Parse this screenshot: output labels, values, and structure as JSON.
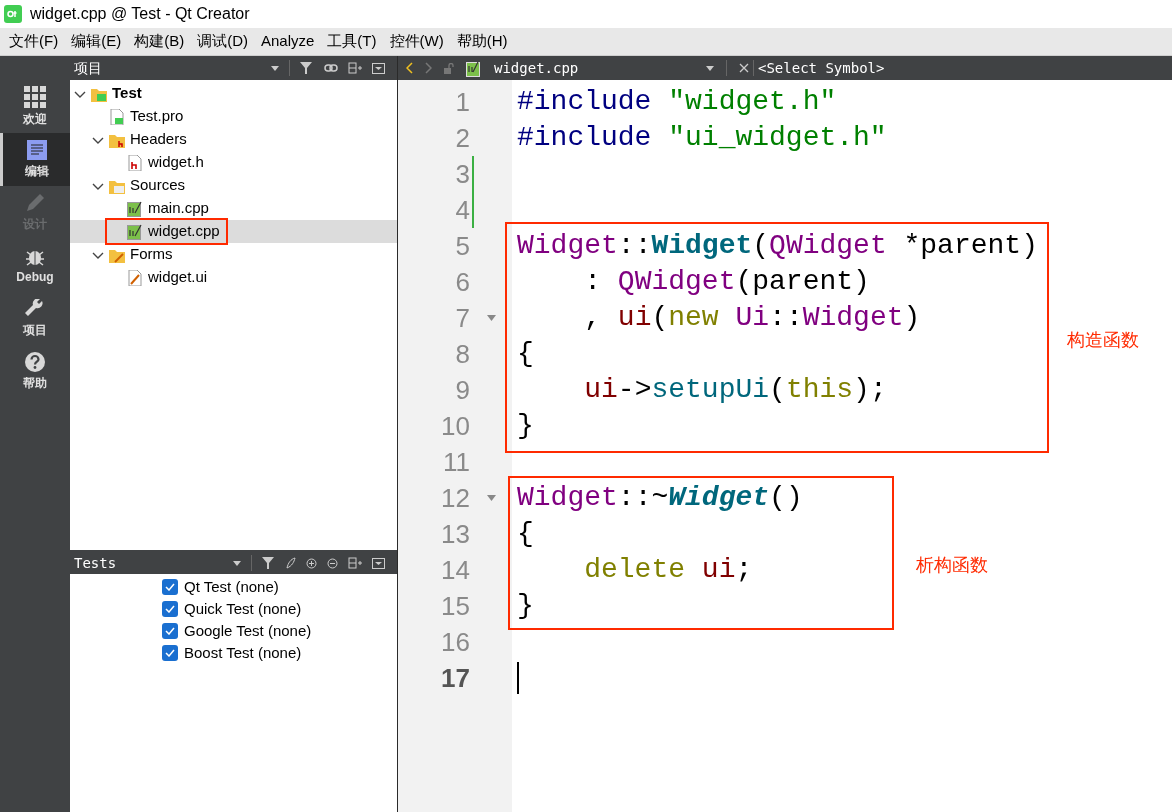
{
  "window": {
    "title": "widget.cpp @ Test - Qt Creator"
  },
  "menu": [
    "文件(F)",
    "编辑(E)",
    "构建(B)",
    "调试(D)",
    "Analyze",
    "工具(T)",
    "控件(W)",
    "帮助(H)"
  ],
  "modes": [
    {
      "label": "欢迎",
      "kind": "welcome",
      "selected": false,
      "disabled": false
    },
    {
      "label": "编辑",
      "kind": "edit",
      "selected": true,
      "disabled": false
    },
    {
      "label": "设计",
      "kind": "design",
      "selected": false,
      "disabled": true
    },
    {
      "label": "Debug",
      "kind": "debug",
      "selected": false,
      "disabled": false
    },
    {
      "label": "项目",
      "kind": "projects",
      "selected": false,
      "disabled": false
    },
    {
      "label": "帮助",
      "kind": "help",
      "selected": false,
      "disabled": false
    }
  ],
  "project_panel": {
    "title": "项目",
    "tree": [
      {
        "label": "Test",
        "kind": "project",
        "expanded": true,
        "selected": false,
        "children": [
          {
            "label": "Test.pro",
            "kind": "pro",
            "selected": false
          },
          {
            "label": "Headers",
            "kind": "headers",
            "expanded": true,
            "selected": false,
            "children": [
              {
                "label": "widget.h",
                "kind": "header",
                "selected": false
              }
            ]
          },
          {
            "label": "Sources",
            "kind": "sources",
            "expanded": true,
            "selected": false,
            "children": [
              {
                "label": "main.cpp",
                "kind": "cpp",
                "selected": false
              },
              {
                "label": "widget.cpp",
                "kind": "cpp",
                "selected": true
              }
            ]
          },
          {
            "label": "Forms",
            "kind": "forms",
            "expanded": true,
            "selected": false,
            "children": [
              {
                "label": "widget.ui",
                "kind": "ui",
                "selected": false
              }
            ]
          }
        ]
      }
    ]
  },
  "tests_panel": {
    "title": "Tests",
    "items": [
      {
        "label": "Qt Test (none)",
        "checked": true
      },
      {
        "label": "Quick Test (none)",
        "checked": true
      },
      {
        "label": "Google Test (none)",
        "checked": true
      },
      {
        "label": "Boost Test (none)",
        "checked": true
      }
    ]
  },
  "editor": {
    "file": "widget.cpp",
    "symbol": "<Select Symbol>",
    "lines": [
      {
        "number": "1",
        "tokens": [
          {
            "kind": "preproc",
            "text": "#include"
          },
          {
            "kind": "string",
            "text": " \"widget.h\""
          }
        ]
      },
      {
        "number": "2",
        "tokens": [
          {
            "kind": "preproc",
            "text": "#include"
          },
          {
            "kind": "string",
            "text": " \"ui_widget.h\""
          }
        ]
      },
      {
        "number": "3",
        "changed": true
      },
      {
        "number": "4",
        "changed": true
      },
      {
        "number": "5",
        "tokens": [
          {
            "kind": "type",
            "text": "Widget"
          },
          {
            "kind": "plain",
            "text": "::"
          },
          {
            "kind": "decl",
            "text": "Widget"
          },
          {
            "kind": "plain",
            "text": "("
          },
          {
            "kind": "type",
            "text": "QWidget"
          },
          {
            "kind": "plain",
            "text": " *parent)"
          }
        ]
      },
      {
        "number": "6",
        "tokens": [
          {
            "kind": "plain",
            "text": "    : "
          },
          {
            "kind": "type",
            "text": "QWidget"
          },
          {
            "kind": "plain",
            "text": "(parent)"
          }
        ]
      },
      {
        "number": "7",
        "foldable": true,
        "tokens": [
          {
            "kind": "plain",
            "text": "    , "
          },
          {
            "kind": "member",
            "text": "ui"
          },
          {
            "kind": "plain",
            "text": "("
          },
          {
            "kind": "keyword",
            "text": "new"
          },
          {
            "kind": "type",
            "text": " Ui"
          },
          {
            "kind": "plain",
            "text": "::"
          },
          {
            "kind": "type",
            "text": "Widget"
          },
          {
            "kind": "plain",
            "text": ")"
          }
        ]
      },
      {
        "number": "8",
        "tokens": [
          {
            "kind": "plain",
            "text": "{"
          }
        ]
      },
      {
        "number": "9",
        "tokens": [
          {
            "kind": "member",
            "text": "    ui"
          },
          {
            "kind": "plain",
            "text": "->"
          },
          {
            "kind": "function",
            "text": "setupUi"
          },
          {
            "kind": "plain",
            "text": "("
          },
          {
            "kind": "keyword",
            "text": "this"
          },
          {
            "kind": "plain",
            "text": ");"
          }
        ]
      },
      {
        "number": "10",
        "tokens": [
          {
            "kind": "plain",
            "text": "}"
          }
        ]
      },
      {
        "number": "11"
      },
      {
        "number": "12",
        "foldable": true,
        "tokens": [
          {
            "kind": "type",
            "text": "Widget"
          },
          {
            "kind": "plain",
            "text": "::~"
          },
          {
            "kind": "decl_italic",
            "text": "Widget"
          },
          {
            "kind": "plain",
            "text": "()"
          }
        ]
      },
      {
        "number": "13",
        "tokens": [
          {
            "kind": "plain",
            "text": "{"
          }
        ]
      },
      {
        "number": "14",
        "tokens": [
          {
            "kind": "keyword",
            "text": "    delete"
          },
          {
            "kind": "member",
            "text": " ui"
          },
          {
            "kind": "plain",
            "text": ";"
          }
        ]
      },
      {
        "number": "15",
        "tokens": [
          {
            "kind": "plain",
            "text": "}"
          }
        ]
      },
      {
        "number": "16"
      },
      {
        "number": "17",
        "current": true
      }
    ]
  },
  "annotations": [
    {
      "label": "构造函数"
    },
    {
      "label": "析构函数"
    }
  ]
}
